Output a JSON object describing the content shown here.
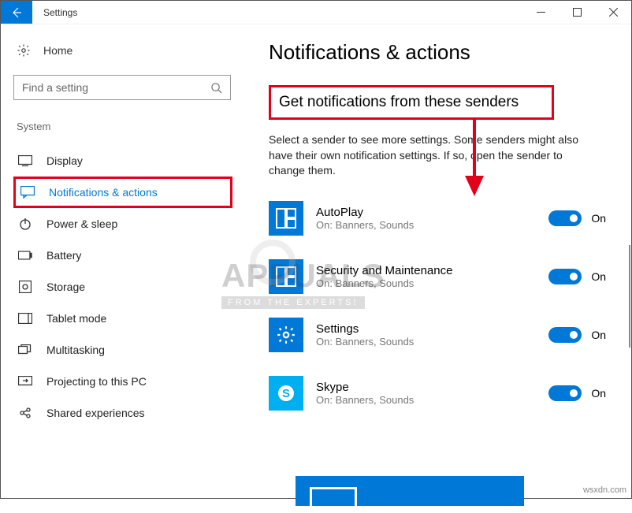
{
  "window": {
    "title": "Settings"
  },
  "sidebar": {
    "home_label": "Home",
    "search_placeholder": "Find a setting",
    "section_label": "System",
    "items": [
      {
        "label": "Display"
      },
      {
        "label": "Notifications & actions"
      },
      {
        "label": "Power & sleep"
      },
      {
        "label": "Battery"
      },
      {
        "label": "Storage"
      },
      {
        "label": "Tablet mode"
      },
      {
        "label": "Multitasking"
      },
      {
        "label": "Projecting to this PC"
      },
      {
        "label": "Shared experiences"
      }
    ]
  },
  "main": {
    "page_title": "Notifications & actions",
    "section_heading": "Get notifications from these senders",
    "subtext": "Select a sender to see more settings. Some senders might also have their own notification settings. If so, open the sender to change them.",
    "senders": [
      {
        "name": "AutoPlay",
        "sub": "On: Banners, Sounds",
        "state": "On"
      },
      {
        "name": "Security and Maintenance",
        "sub": "On: Banners, Sounds",
        "state": "On"
      },
      {
        "name": "Settings",
        "sub": "On: Banners, Sounds",
        "state": "On"
      },
      {
        "name": "Skype",
        "sub": "On: Banners, Sounds",
        "state": "On"
      }
    ]
  },
  "watermark": {
    "big": "APPUALS",
    "tag": "FROM THE EXPERTS!"
  },
  "footer": "wsxdn.com"
}
